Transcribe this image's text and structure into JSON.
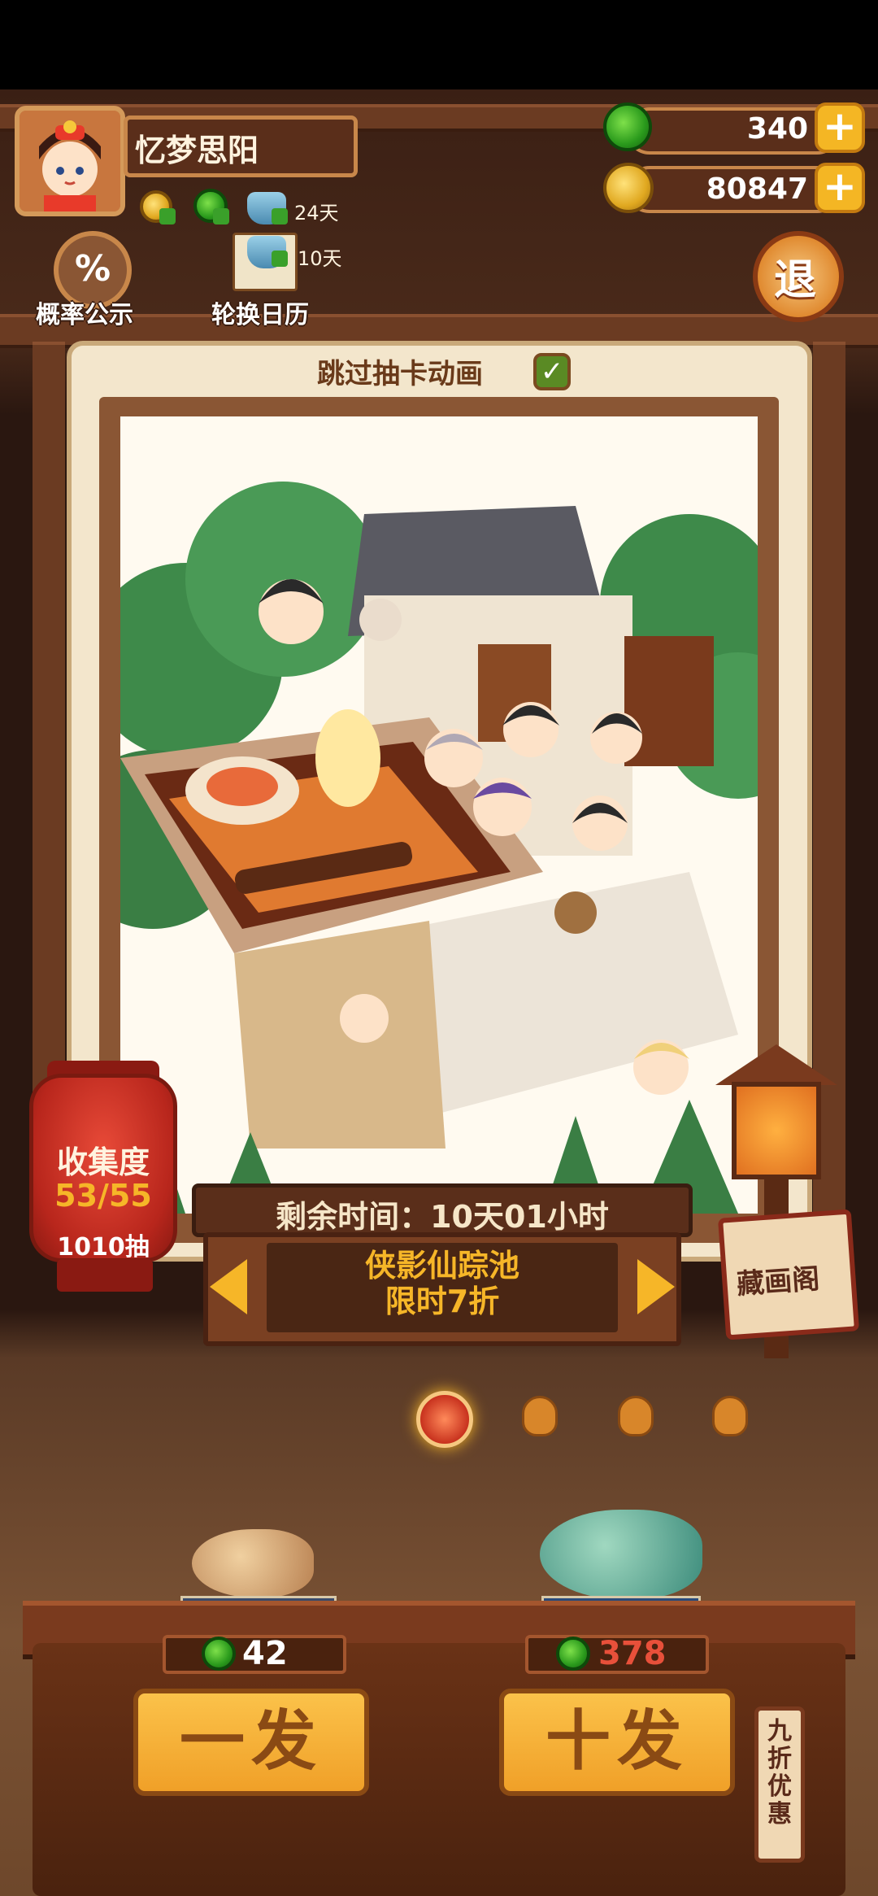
{
  "player": {
    "name": "忆梦思阳"
  },
  "currencies": {
    "jade": "340",
    "coins": "80847"
  },
  "status_icons": [
    {
      "icon": "gold-coin-icon",
      "text": ""
    },
    {
      "icon": "jade-icon",
      "text": ""
    },
    {
      "icon": "bowl-icon",
      "text": "24天"
    },
    {
      "icon": "bowl-icon",
      "text": "10天"
    }
  ],
  "top_buttons": {
    "probability": "概率公示",
    "rotation_calendar": "轮换日历",
    "exit": "退"
  },
  "skip_animation": {
    "label": "跳过抽卡动画",
    "checked": true
  },
  "collection": {
    "title": "收集度",
    "progress": "53/55",
    "draws": "1010抽"
  },
  "timer": {
    "label": "剩余时间：10天01小时"
  },
  "pool": {
    "name": "侠影仙踪池",
    "sale": "限时7折"
  },
  "hall": {
    "label": "藏画阁"
  },
  "pages": {
    "count": 4,
    "active": 0
  },
  "draw": {
    "single": {
      "label": "一发",
      "cost": "42"
    },
    "ten": {
      "label": "十发",
      "cost": "378"
    }
  },
  "discount_tag": "九折优惠",
  "colors": {
    "accent": "#f4b624",
    "cost_red": "#e8503a",
    "pool_gold": "#f6b628"
  }
}
